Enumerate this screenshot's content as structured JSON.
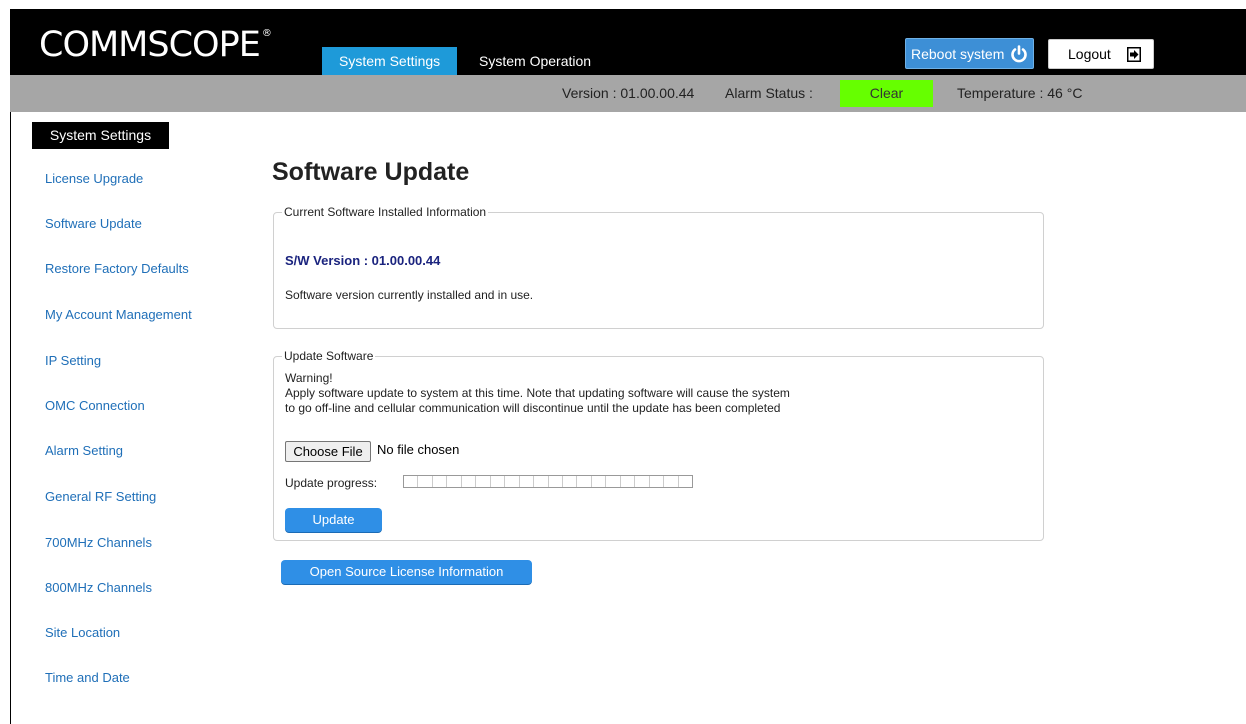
{
  "header": {
    "logo_text": "COMMSCOPE",
    "logo_mark": "®",
    "tabs": [
      {
        "label": "System Settings",
        "active": true
      },
      {
        "label": "System Operation",
        "active": false
      }
    ],
    "reboot_label": "Reboot system",
    "logout_label": "Logout"
  },
  "status": {
    "version": "Version : 01.00.00.44",
    "alarm_label": "Alarm Status :",
    "alarm_value": "Clear",
    "alarm_color": "#66ff00",
    "temperature": "Temperature : 46 °C"
  },
  "sidebar": {
    "title": "System Settings",
    "items": [
      "License Upgrade",
      "Software Update",
      "Restore Factory Defaults",
      "My Account Management",
      "IP Setting",
      "OMC Connection",
      "Alarm Setting",
      "General RF Setting",
      "700MHz Channels",
      "800MHz Channels",
      "Site Location",
      "Time and Date"
    ]
  },
  "main": {
    "title": "Software Update",
    "current": {
      "legend": "Current Software Installed Information",
      "version": "S/W Version : 01.00.00.44",
      "description": "Software version currently installed and in use."
    },
    "update": {
      "legend": "Update Software",
      "warning_title": "Warning!",
      "warning_line1": "Apply software update to system at this time. Note that updating software will cause the system",
      "warning_line2": "to go off-line and cellular communication will discontinue until the update has been completed",
      "choose_file_label": "Choose File",
      "no_file_text": "No file chosen",
      "progress_label": "Update progress:",
      "progress_value": 0,
      "update_button": "Update"
    },
    "open_source_button": "Open Source License Information"
  },
  "colors": {
    "accent": "#1e9ad9",
    "button": "#2f8fe6",
    "link": "#1f6fb8",
    "status_bar": "#a6a6a6"
  }
}
